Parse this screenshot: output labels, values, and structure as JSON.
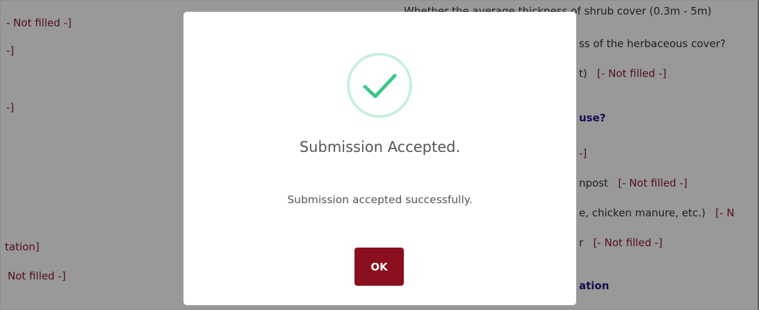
{
  "background": {
    "left": {
      "line1": "- Not filled -]",
      "line2": "-]",
      "line3": "-]",
      "line4": "tation]",
      "line5": "Not filled -]"
    },
    "right": {
      "line1": "Whether the average thickness of shrub cover (0.3m - 5m)",
      "line2": "ss of the herbaceous cover?",
      "line3_prefix": "t)",
      "line3_value": "[- Not filled -]",
      "line4": "use?",
      "line5": "-]",
      "line6_prefix": "npost",
      "line6_value": "[- Not filled -]",
      "line7_prefix": "e, chicken manure, etc.)",
      "line7_value": "[- N",
      "line8_prefix": "r",
      "line8_value": "[- Not filled -]",
      "line9": "ation"
    }
  },
  "modal": {
    "icon": "success-check-icon",
    "title": "Submission Accepted.",
    "message": "Submission accepted successfully.",
    "ok_label": "OK"
  },
  "colors": {
    "overlay": "rgba(0,0,0,0.40)",
    "ok_button": "#8a0f1f",
    "success": "#3ec78a",
    "success_ring": "#c8efdc",
    "not_filled": "#8b1a2b",
    "section_heading": "#1c1680"
  }
}
